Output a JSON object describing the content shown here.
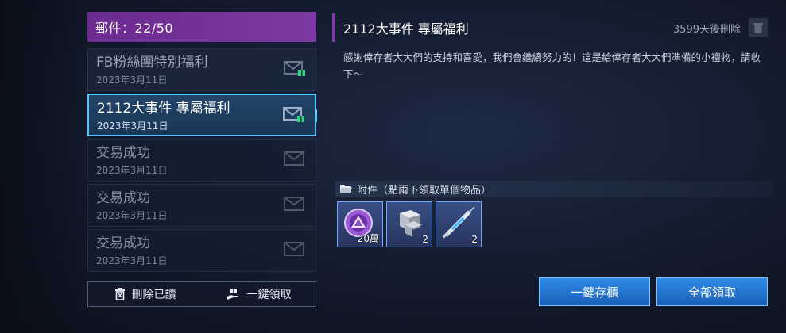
{
  "mailbox": {
    "count_label": "郵件：22/50"
  },
  "mails": [
    {
      "title": "FB粉絲團特別福利",
      "date": "2023年3月11日",
      "icon": "gift-envelope-icon",
      "state": "unread"
    },
    {
      "title": "2112大事件 專屬福利",
      "date": "2023年3月11日",
      "icon": "gift-envelope-icon",
      "state": "selected"
    },
    {
      "title": "交易成功",
      "date": "2023年3月11日",
      "icon": "envelope-icon",
      "state": "read"
    },
    {
      "title": "交易成功",
      "date": "2023年3月11日",
      "icon": "envelope-icon",
      "state": "read"
    },
    {
      "title": "交易成功",
      "date": "2023年3月11日",
      "icon": "envelope-icon",
      "state": "read"
    }
  ],
  "bottom_actions": {
    "delete_read": "刪除已讀",
    "claim_all": "一鍵領取"
  },
  "detail": {
    "title": "2112大事件 專屬福利",
    "expire": "3599天後刪除",
    "body": "感謝倖存者大大們的支持和喜愛，我們會繼續努力的！這是給倖存者大大們準備的小禮物，請收下～",
    "attach_label": "附件（點兩下領取單個物品）",
    "items": [
      {
        "icon": "purple-crystal-icon",
        "qty": "20萬"
      },
      {
        "icon": "metal-block-icon",
        "qty": "2"
      },
      {
        "icon": "syringe-icon",
        "qty": "2"
      }
    ]
  },
  "actions": {
    "store_all": "一鍵存櫃",
    "claim_all": "全部領取"
  },
  "colors": {
    "accent_purple": "#7d3aa3",
    "selected_border": "#56c8ff",
    "button_blue": "#2f8ce6"
  }
}
